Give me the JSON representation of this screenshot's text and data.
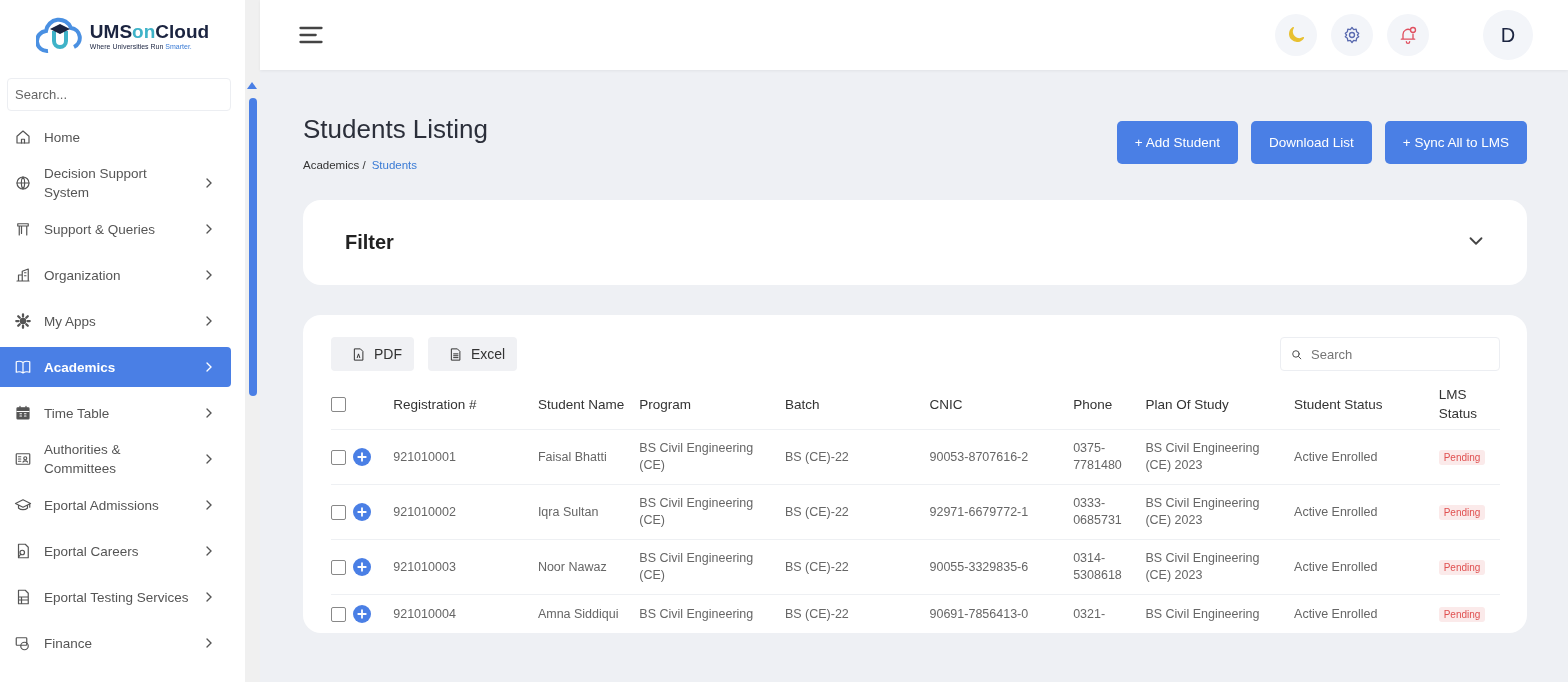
{
  "brand": {
    "name_part1": "UMS",
    "name_part2": "on",
    "name_part3": "Cloud",
    "tagline": "Where Universities Run ",
    "tagline_highlight": "Smarter."
  },
  "sidebar": {
    "search_placeholder": "Search...",
    "items": [
      {
        "label": "Home",
        "has_children": false,
        "selected": false
      },
      {
        "label": "Decision Support System",
        "has_children": true,
        "selected": false
      },
      {
        "label": "Support & Queries",
        "has_children": true,
        "selected": false
      },
      {
        "label": "Organization",
        "has_children": true,
        "selected": false
      },
      {
        "label": "My Apps",
        "has_children": true,
        "selected": false
      },
      {
        "label": "Academics",
        "has_children": true,
        "selected": true
      },
      {
        "label": "Time Table",
        "has_children": true,
        "selected": false
      },
      {
        "label": "Authorities & Committees",
        "has_children": true,
        "selected": false
      },
      {
        "label": "Eportal Admissions",
        "has_children": true,
        "selected": false
      },
      {
        "label": "Eportal Careers",
        "has_children": true,
        "selected": false
      },
      {
        "label": "Eportal Testing Services",
        "has_children": true,
        "selected": false
      },
      {
        "label": "Finance",
        "has_children": true,
        "selected": false
      }
    ]
  },
  "header": {
    "avatar_letter": "D"
  },
  "page": {
    "title": "Students Listing",
    "breadcrumb": [
      "Academics /",
      "Students"
    ],
    "actions": [
      "+ Add Student",
      "Download List",
      "+ Sync All to LMS"
    ]
  },
  "filter": {
    "title": "Filter",
    "expanded": false
  },
  "table": {
    "select_all_checked": false,
    "exports": [
      "PDF",
      "Excel"
    ],
    "search_placeholder": "Search",
    "columns": [
      "Registration #",
      "Student Name",
      "Program",
      "Batch",
      "CNIC",
      "Phone",
      "Plan Of Study",
      "Student Status",
      "LMS Status"
    ],
    "rows": [
      {
        "checked": false,
        "cells": [
          "921010001",
          "Faisal Bhatti",
          "BS Civil Engineering (CE)",
          "BS (CE)-22",
          "90053-8707616-2",
          "0375-7781480",
          "BS Civil Engineering (CE) 2023",
          "Active Enrolled",
          "Pending"
        ]
      },
      {
        "checked": false,
        "cells": [
          "921010002",
          "Iqra Sultan",
          "BS Civil Engineering (CE)",
          "BS (CE)-22",
          "92971-6679772-1",
          "0333-0685731",
          "BS Civil Engineering (CE) 2023",
          "Active Enrolled",
          "Pending"
        ]
      },
      {
        "checked": false,
        "cells": [
          "921010003",
          "Noor Nawaz",
          "BS Civil Engineering (CE)",
          "BS (CE)-22",
          "90055-3329835-6",
          "0314-5308618",
          "BS Civil Engineering (CE) 2023",
          "Active Enrolled",
          "Pending"
        ]
      },
      {
        "checked": false,
        "cells": [
          "921010004",
          "Amna Siddiqui",
          "BS Civil Engineering",
          "BS (CE)-22",
          "90691-7856413-0",
          "0321-",
          "BS Civil Engineering",
          "Active Enrolled",
          "Pending"
        ]
      }
    ]
  }
}
